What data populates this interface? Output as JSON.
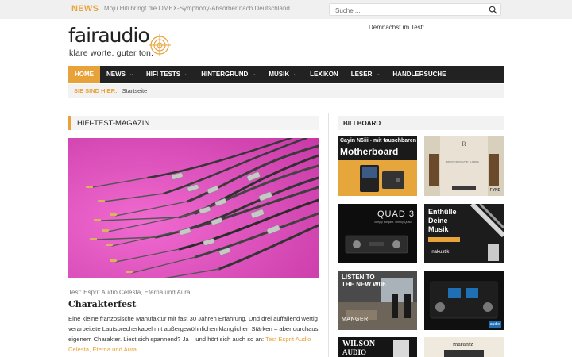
{
  "topbar": {
    "news_label": "NEWS",
    "ticker": "Moju Hifi bringt die OMEX-Symphony-Absorber nach Deutschland",
    "search_placeholder": "Suche ..."
  },
  "logo": {
    "wordmark_fair": "fair",
    "wordmark_audio": "audio",
    "tagline": "klare worte. guter ton."
  },
  "header": {
    "coming_soon": "Demnächst im Test:"
  },
  "nav": {
    "items": [
      {
        "label": "HOME"
      },
      {
        "label": "NEWS"
      },
      {
        "label": "HIFI TESTS"
      },
      {
        "label": "HINTERGRUND"
      },
      {
        "label": "MUSIK"
      },
      {
        "label": "LEXIKON"
      },
      {
        "label": "LESER"
      },
      {
        "label": "HÄNDLERSUCHE"
      }
    ],
    "chevron": "⌄"
  },
  "breadcrumb": {
    "label": "SIE SIND HIER:",
    "current": "Startseite"
  },
  "section": {
    "title": "HIFI-TEST-MAGAZIN"
  },
  "article": {
    "category": "Test: Esprit Audio Celesta, Eterna und Aura",
    "title": "Charakterfest",
    "excerpt": "Eine kleine französische Manufaktur mit fast 30 Jahren Erfahrung. Und drei auffallend wertig verarbeitete Lautsprecherkabel mit außergewöhnlichen klanglichen Stärken – aber durchaus eigenem Charakter. Liest sich spannend? Ja – und hört sich auch so an: ",
    "link": "Test Esprit Audio Celesta, Eterna und Aura"
  },
  "billboard": {
    "title": "BILLBOARD",
    "ads": [
      {
        "line1": "Cayin N6iii - mit tauschbaren",
        "line2": "Motherboard"
      },
      {
        "line1": "REFERENCE AURA",
        "line2": "FYNE"
      },
      {
        "line1": "QUAD 3",
        "line2": "Simply Elegant. Simply Quad."
      },
      {
        "line1": "Enthülle",
        "line2": "Deine",
        "line3": "Musik",
        "line4": "inakustik"
      },
      {
        "line1": "LISTEN TO",
        "line2": "THE NEW W06",
        "line3": "MANGER"
      },
      {
        "line1": "audio"
      },
      {
        "line1": "WILSON",
        "line2": "AUDIO"
      },
      {
        "line1": "marantz"
      }
    ]
  },
  "colors": {
    "accent": "#e8a23a",
    "nav_bg": "#222222",
    "feature_bg": "#e054c0"
  }
}
